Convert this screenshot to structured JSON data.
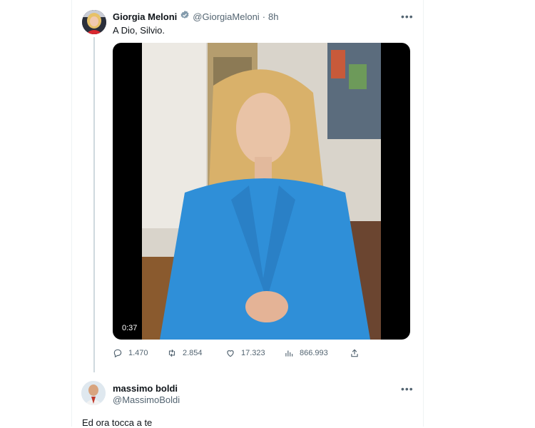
{
  "tweet1": {
    "display_name": "Giorgia Meloni",
    "handle": "@GiorgiaMeloni",
    "separator": "·",
    "age": "8h",
    "more_label": "•••",
    "text": "A Dio, Silvio.",
    "video_duration": "0:37",
    "stats": {
      "replies": "1.470",
      "retweets": "2.854",
      "likes": "17.323",
      "views": "866.993"
    }
  },
  "tweet2": {
    "display_name": "massimo boldi",
    "handle": "@MassimoBoldi",
    "more_label": "•••",
    "text": "Ed ora tocca a te"
  },
  "icons": {
    "verified": "verified-badge-icon",
    "reply": "reply-icon",
    "retweet": "retweet-icon",
    "like": "heart-icon",
    "views": "views-icon",
    "share": "share-icon"
  },
  "colors": {
    "verified_badge": "#829aab",
    "secondary_text": "#536471",
    "jacket_blue": "#2f8fd8"
  }
}
